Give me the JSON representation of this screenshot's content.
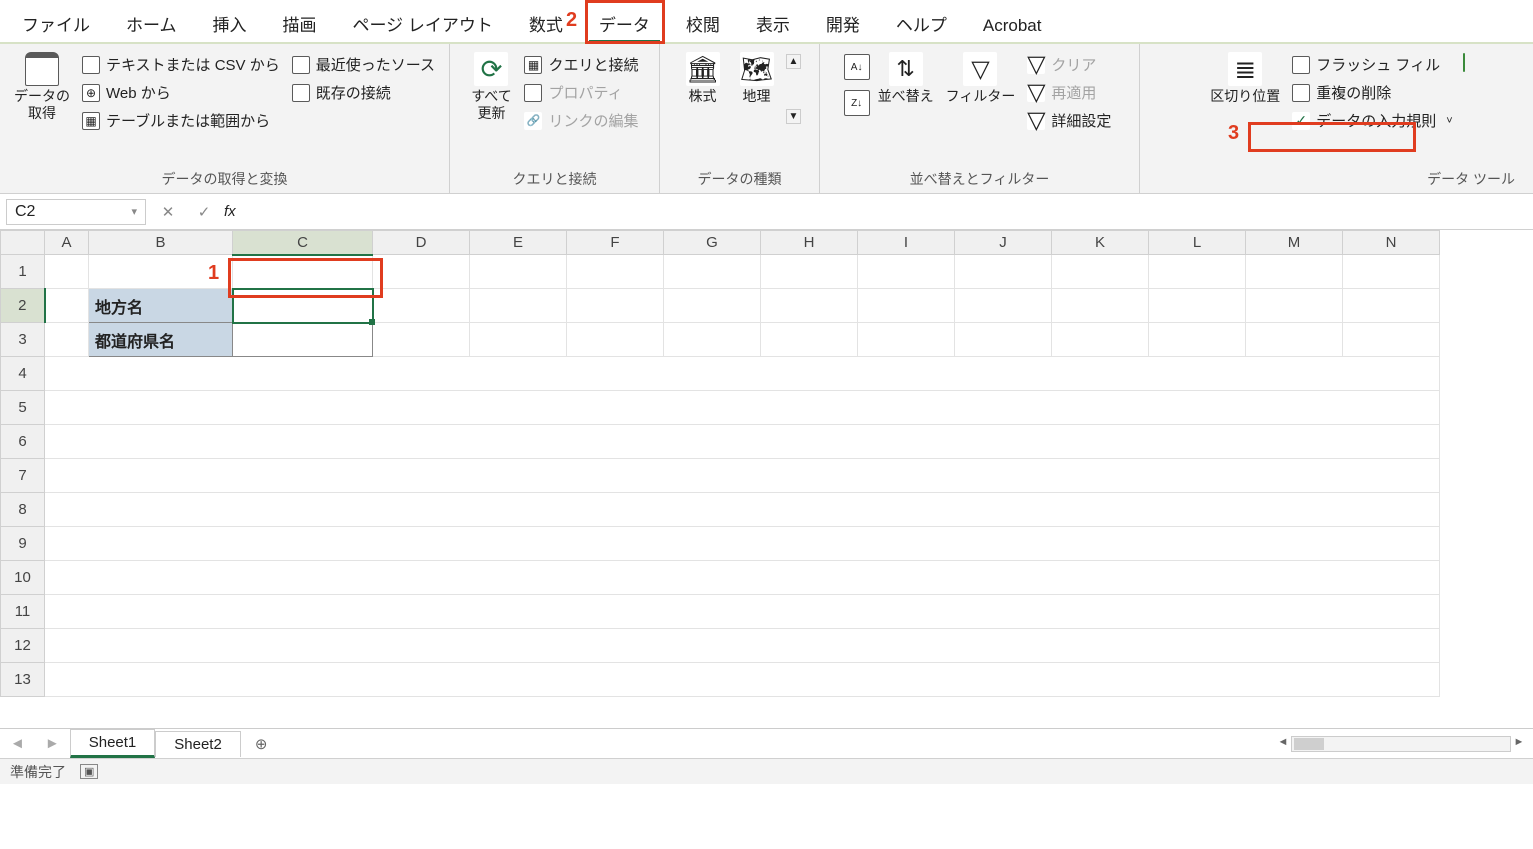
{
  "tabs": [
    "ファイル",
    "ホーム",
    "挿入",
    "描画",
    "ページ レイアウト",
    "数式",
    "データ",
    "校閲",
    "表示",
    "開発",
    "ヘルプ",
    "Acrobat"
  ],
  "active_tab_index": 6,
  "ribbon": {
    "group1": {
      "label": "データの取得と変換",
      "get_data": "データの\n取得",
      "csv": "テキストまたは CSV から",
      "web": "Web から",
      "table": "テーブルまたは範囲から",
      "recent": "最近使ったソース",
      "existing": "既存の接続"
    },
    "group2": {
      "label": "クエリと接続",
      "refresh": "すべて\n更新",
      "queries": "クエリと接続",
      "properties": "プロパティ",
      "editlinks": "リンクの編集"
    },
    "group3": {
      "label": "データの種類",
      "stocks": "株式",
      "geography": "地理"
    },
    "group4": {
      "label": "並べ替えとフィルター",
      "sort": "並べ替え",
      "filter": "フィルター",
      "clear": "クリア",
      "reapply": "再適用",
      "advanced": "詳細設定"
    },
    "group5": {
      "label": "データ ツール",
      "split": "区切り位置",
      "flash": "フラッシュ フィル",
      "dedup": "重複の削除",
      "validation": "データの入力規則"
    }
  },
  "namebox": "C2",
  "formula": "",
  "columns": [
    "A",
    "B",
    "C",
    "D",
    "E",
    "F",
    "G",
    "H",
    "I",
    "J",
    "K",
    "L",
    "M",
    "N"
  ],
  "rows": [
    1,
    2,
    3,
    4,
    5,
    6,
    7,
    8,
    9,
    10,
    11,
    12,
    13
  ],
  "cells": {
    "B2": "地方名",
    "B3": "都道府県名"
  },
  "callouts": {
    "one": "1",
    "two": "2",
    "three": "3"
  },
  "sheet_tabs": [
    "Sheet1",
    "Sheet2"
  ],
  "active_sheet_index": 0,
  "status": "準備完了"
}
